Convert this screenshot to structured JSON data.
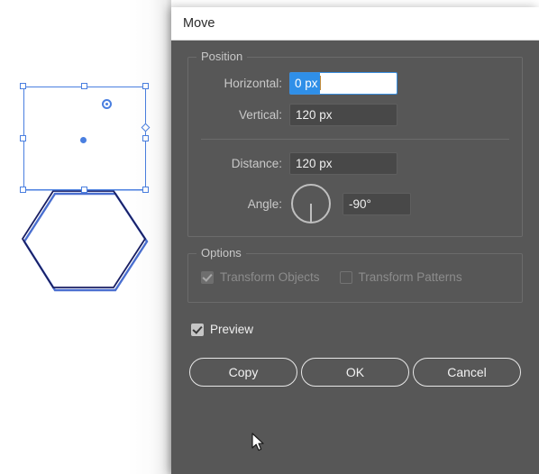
{
  "app": {
    "canvas": {
      "selection": {
        "name": "selection-bounding-box",
        "handle_color": "#4a7fe0"
      },
      "shapes": [
        {
          "name": "hexagon",
          "stroke": "#1a1f63"
        },
        {
          "name": "hexagon-move-preview",
          "stroke": "#4a6fd0"
        }
      ]
    }
  },
  "dialog": {
    "title": "Move",
    "position_group": {
      "legend": "Position",
      "fields": [
        {
          "label": "Horizontal:",
          "value": "0 px",
          "focused": true
        },
        {
          "label": "Vertical:",
          "value": "120 px",
          "focused": false
        },
        {
          "label": "Distance:",
          "value": "120 px",
          "focused": false
        },
        {
          "label": "Angle:",
          "value": "-90°",
          "focused": false
        }
      ],
      "angle_degrees": -90
    },
    "options_group": {
      "legend": "Options",
      "checkboxes": [
        {
          "label": "Transform Objects",
          "checked": true,
          "disabled": true
        },
        {
          "label": "Transform Patterns",
          "checked": false,
          "disabled": true
        }
      ]
    },
    "preview": {
      "label": "Preview",
      "checked": true,
      "disabled": false
    },
    "buttons": [
      {
        "label": "Copy"
      },
      {
        "label": "OK"
      },
      {
        "label": "Cancel"
      }
    ]
  }
}
